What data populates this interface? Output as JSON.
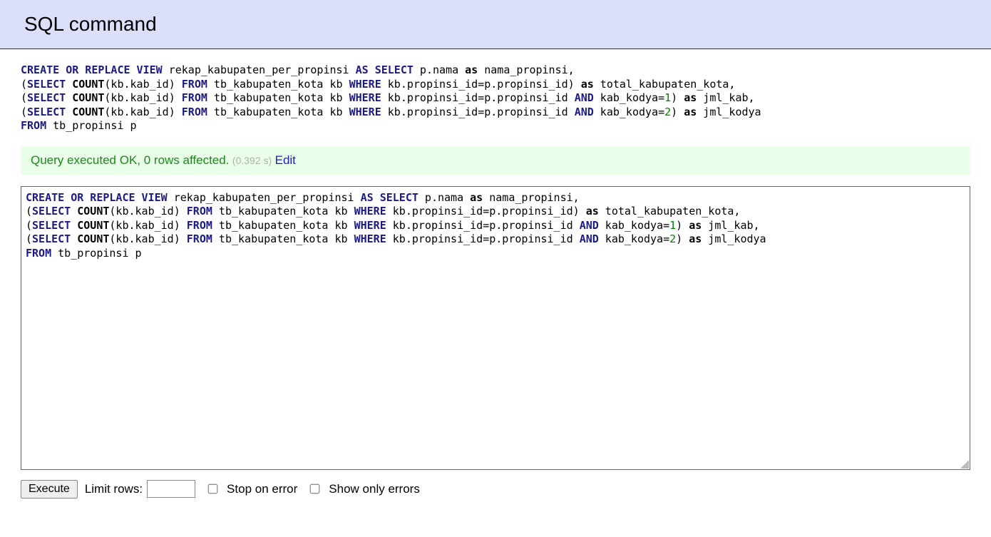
{
  "header": {
    "title": "SQL command"
  },
  "sql": {
    "tokens": [
      {
        "t": "CREATE OR REPLACE VIEW",
        "c": "kw"
      },
      {
        "t": " rekap_kabupaten_per_propinsi "
      },
      {
        "t": "AS",
        "c": "kw"
      },
      {
        "t": " "
      },
      {
        "t": "SELECT",
        "c": "kw"
      },
      {
        "t": " p.nama "
      },
      {
        "t": "as",
        "c": "bkw"
      },
      {
        "t": " nama_propinsi,\n"
      },
      {
        "t": "("
      },
      {
        "t": "SELECT",
        "c": "kw"
      },
      {
        "t": " "
      },
      {
        "t": "COUNT",
        "c": "bkw"
      },
      {
        "t": "(kb.kab_id) "
      },
      {
        "t": "FROM",
        "c": "kw"
      },
      {
        "t": " tb_kabupaten_kota kb "
      },
      {
        "t": "WHERE",
        "c": "kw"
      },
      {
        "t": " kb.propinsi_id=p.propinsi_id) "
      },
      {
        "t": "as",
        "c": "bkw"
      },
      {
        "t": " total_kabupaten_kota,\n"
      },
      {
        "t": "("
      },
      {
        "t": "SELECT",
        "c": "kw"
      },
      {
        "t": " "
      },
      {
        "t": "COUNT",
        "c": "bkw"
      },
      {
        "t": "(kb.kab_id) "
      },
      {
        "t": "FROM",
        "c": "kw"
      },
      {
        "t": " tb_kabupaten_kota kb "
      },
      {
        "t": "WHERE",
        "c": "kw"
      },
      {
        "t": " kb.propinsi_id=p.propinsi_id "
      },
      {
        "t": "AND",
        "c": "kw"
      },
      {
        "t": " kab_kodya="
      },
      {
        "t": "1",
        "c": "num"
      },
      {
        "t": ") "
      },
      {
        "t": "as",
        "c": "bkw"
      },
      {
        "t": " jml_kab,\n"
      },
      {
        "t": "("
      },
      {
        "t": "SELECT",
        "c": "kw"
      },
      {
        "t": " "
      },
      {
        "t": "COUNT",
        "c": "bkw"
      },
      {
        "t": "(kb.kab_id) "
      },
      {
        "t": "FROM",
        "c": "kw"
      },
      {
        "t": " tb_kabupaten_kota kb "
      },
      {
        "t": "WHERE",
        "c": "kw"
      },
      {
        "t": " kb.propinsi_id=p.propinsi_id "
      },
      {
        "t": "AND",
        "c": "kw"
      },
      {
        "t": " kab_kodya="
      },
      {
        "t": "2",
        "c": "num"
      },
      {
        "t": ") "
      },
      {
        "t": "as",
        "c": "bkw"
      },
      {
        "t": " jml_kodya\n"
      },
      {
        "t": "FROM",
        "c": "kw"
      },
      {
        "t": " tb_propinsi p"
      }
    ]
  },
  "result": {
    "message": "Query executed OK, 0 rows affected.",
    "time": "(0.392 s)",
    "edit_label": "Edit"
  },
  "controls": {
    "execute_label": "Execute",
    "limit_label": "Limit rows:",
    "limit_value": "",
    "stop_on_error_label": "Stop on error",
    "show_only_errors_label": "Show only errors",
    "stop_on_error_checked": false,
    "show_only_errors_checked": false
  }
}
